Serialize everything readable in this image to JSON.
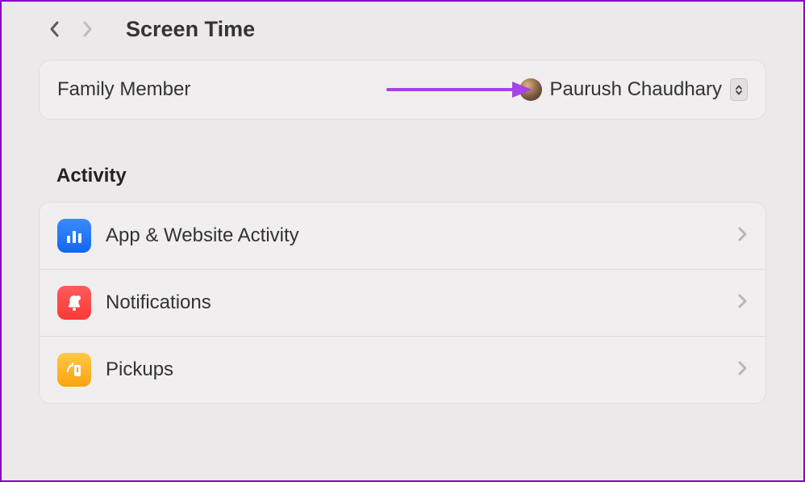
{
  "header": {
    "title": "Screen Time"
  },
  "family": {
    "label": "Family Member",
    "selected": "Paurush Chaudhary"
  },
  "activity": {
    "section_title": "Activity",
    "rows": [
      {
        "label": "App & Website Activity"
      },
      {
        "label": "Notifications"
      },
      {
        "label": "Pickups"
      }
    ]
  }
}
